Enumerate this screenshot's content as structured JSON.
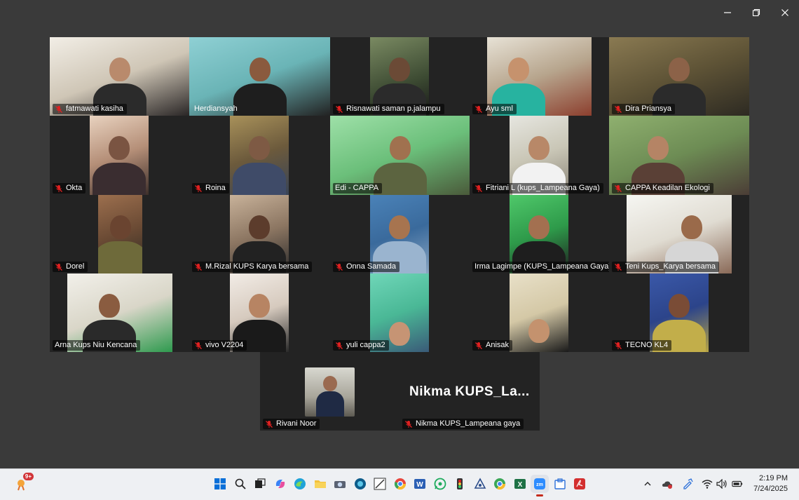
{
  "window": {
    "minimize_icon": "minimize-icon",
    "restore_icon": "restore-icon",
    "close_icon": "close-icon"
  },
  "participants": [
    {
      "name": "fatmawati kasiha",
      "muted": true
    },
    {
      "name": "Herdiansyah",
      "muted": false,
      "speaking": true
    },
    {
      "name": "Risnawati saman p.jalampu",
      "muted": true
    },
    {
      "name": "Ayu sml",
      "muted": true
    },
    {
      "name": "Dira Priansya",
      "muted": true
    },
    {
      "name": "Okta",
      "muted": true
    },
    {
      "name": "Roina",
      "muted": true
    },
    {
      "name": "Edi - CAPPA",
      "muted": false
    },
    {
      "name": "Fitriani L (kups_Lampeana Gaya)",
      "muted": true
    },
    {
      "name": "CAPPA Keadilan Ekologi",
      "muted": true
    },
    {
      "name": "Dorel",
      "muted": true
    },
    {
      "name": "M.Rizal KUPS Karya bersama",
      "muted": true
    },
    {
      "name": "Onna Samada",
      "muted": true
    },
    {
      "name": "Irma Lagimpe (KUPS_Lampeana Gaya)",
      "muted": false
    },
    {
      "name": "Teni Kups_Karya bersama",
      "muted": true
    },
    {
      "name": "Arna Kups Niu Kencana",
      "muted": false
    },
    {
      "name": "vivo V2204",
      "muted": true
    },
    {
      "name": "yuli cappa2",
      "muted": true
    },
    {
      "name": "Anisak",
      "muted": true
    },
    {
      "name": "TECNO KL4",
      "muted": true
    },
    {
      "name": "Rivani Noor",
      "muted": true
    },
    {
      "name": "Nikma KUPS_Lampeana gaya",
      "muted": true
    }
  ],
  "no_video_display_name": "Nikma  KUPS_La...",
  "colors": {
    "background": "#3a3a3a",
    "tile_background": "#232323",
    "active_speaker_border": "#2ecf6a",
    "muted_icon": "#e02020"
  },
  "taskbar": {
    "weather_badge": "9+",
    "apps": [
      "start-icon",
      "search-icon",
      "task-view-icon",
      "copilot-icon",
      "edge-icon",
      "file-explorer-icon",
      "camera-icon",
      "edge-dev-icon",
      "paint-icon",
      "chrome-icon",
      "word-icon",
      "whatsapp-icon",
      "traffic-light-icon",
      "network-share-icon",
      "chrome-profile-icon",
      "excel-icon",
      "zoom-icon",
      "store-icon",
      "acrobat-icon"
    ],
    "active_app": "zoom-icon",
    "tray": [
      "chevron-up-icon",
      "onedrive-icon",
      "pen-icon",
      "wifi-icon",
      "volume-icon",
      "battery-icon"
    ],
    "time": "2:19 PM",
    "date": "7/24/2025"
  }
}
